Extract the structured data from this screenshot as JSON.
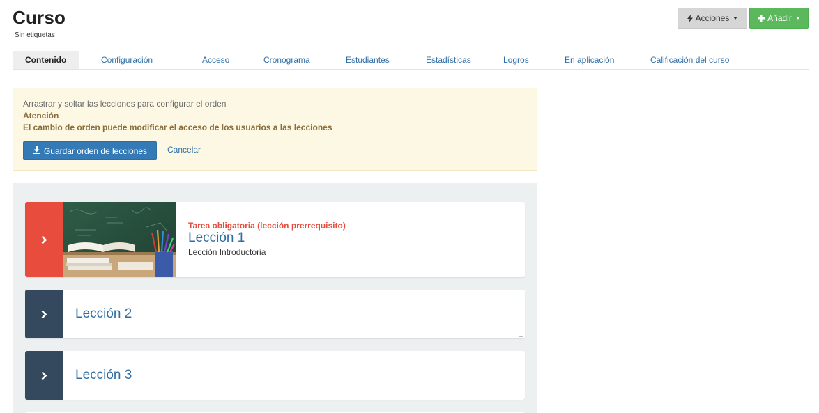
{
  "header": {
    "title": "Curso",
    "subtitle": "Sin etiquetas",
    "actions_label": "Acciones",
    "add_label": "Añadir"
  },
  "tabs": [
    {
      "label": "Contenido",
      "active": true
    },
    {
      "label": "Configuración"
    },
    {
      "label": "Acceso"
    },
    {
      "label": "Cronograma"
    },
    {
      "label": "Estudiantes"
    },
    {
      "label": "Estadísticas"
    },
    {
      "label": "Logros"
    },
    {
      "label": "En aplicación"
    },
    {
      "label": "Calificación del curso"
    }
  ],
  "alert": {
    "line1": "Arrastrar y soltar las lecciones para configurar el orden",
    "line2": "Atención",
    "line3": "El cambio de orden puede modificar el acceso de los usuarios a las lecciones",
    "save_label": "Guardar orden de lecciones",
    "cancel_label": "Cancelar"
  },
  "lessons": [
    {
      "tag": "Tarea obligatoria (lección prerrequisito)",
      "title": "Lección 1",
      "description": "Lección Introductoria",
      "handle_color": "#e74c3c"
    },
    {
      "title": "Lección 2",
      "handle_color": "#34495e"
    },
    {
      "title": "Lección 3",
      "handle_color": "#34495e"
    }
  ],
  "colors": {
    "primary": "#337ab7",
    "success": "#5cb85c",
    "danger": "#e74c3c",
    "dark": "#34495e",
    "link": "#2f6ea5",
    "alert_bg": "#fcf8e3"
  },
  "icons": {
    "actions": "bolt-icon",
    "add": "plus-icon",
    "save": "download-icon",
    "lesson_handle": "chevron-right-icon"
  }
}
